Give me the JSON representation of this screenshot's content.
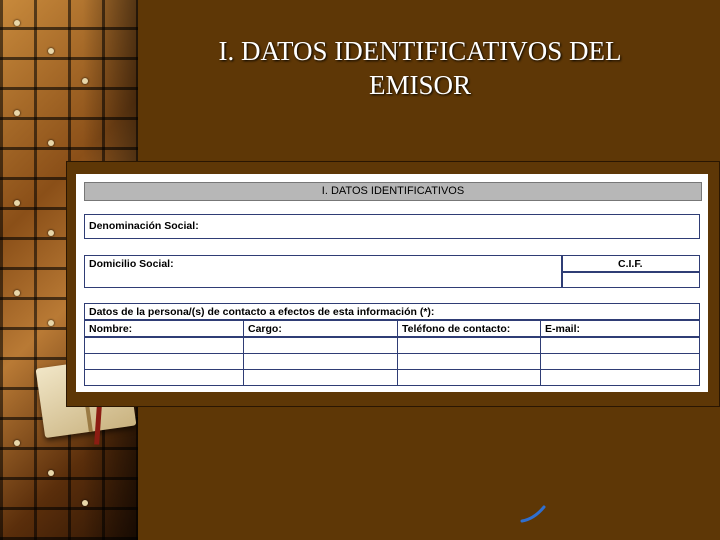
{
  "slide": {
    "title_line1": "I. DATOS IDENTIFICATIVOS DEL",
    "title_line2": "EMISOR"
  },
  "form": {
    "header": "I. DATOS IDENTIFICATIVOS",
    "denominacion_label": "Denominación Social:",
    "domicilio_label": "Domicilio Social:",
    "cif_label": "C.I.F.",
    "contacto_label": "Datos de la persona/(s) de contacto a efectos de esta información (*):",
    "columns": [
      "Nombre:",
      "Cargo:",
      "Teléfono de contacto:",
      "E-mail:"
    ]
  },
  "colors": {
    "background": "#5e3706",
    "title": "#ffffff",
    "form_border": "#2f3d75",
    "header_fill": "#b7b7b7"
  }
}
